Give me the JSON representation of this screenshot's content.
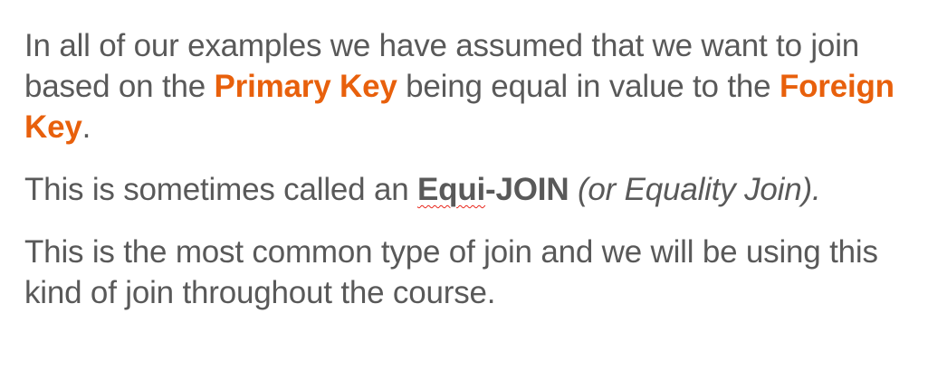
{
  "colors": {
    "text": "#595959",
    "accent": "#e8600c",
    "spellcheck_underline": "#e8261b"
  },
  "paragraph1": {
    "text_before": "In all of our examples we have assumed that we want to join based on the ",
    "highlight1": "Primary Key",
    "text_middle": " being equal in value to the ",
    "highlight2": "Foreign Key",
    "text_after": "."
  },
  "paragraph2": {
    "text_before": "This is sometimes called an ",
    "term_word": "Equi",
    "term_rest": "-JOIN",
    "space": " ",
    "italic_note": "(or Equality Join)."
  },
  "paragraph3": {
    "text": "This is the most common type of join and we will be using this kind of join throughout the course."
  }
}
